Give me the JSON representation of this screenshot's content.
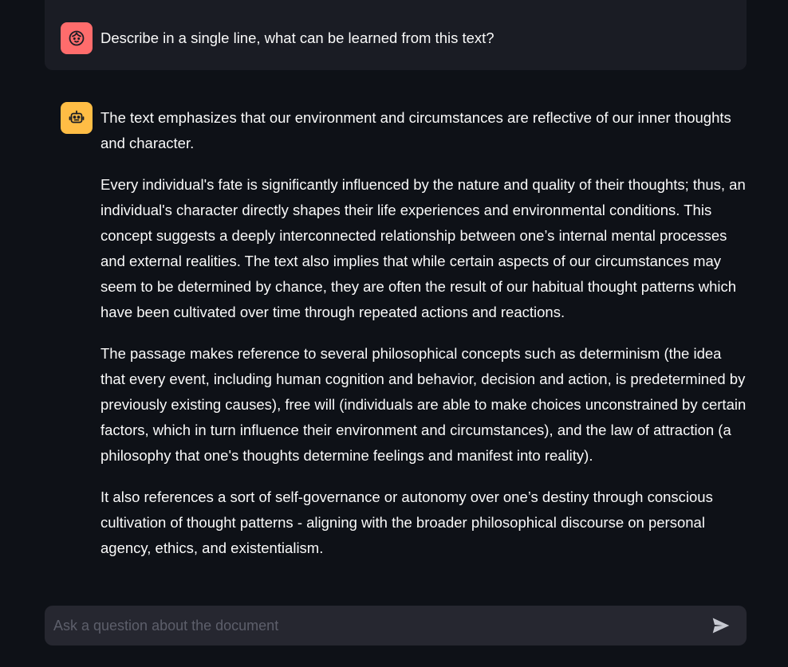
{
  "chat": {
    "user_message": {
      "avatar_icon": "user-face-icon",
      "text": "Describe in a single line, what can be learned from this text?"
    },
    "assistant_message": {
      "avatar_icon": "robot-icon",
      "paragraphs": [
        "The text emphasizes that our environment and circumstances are reflective of our inner thoughts and character.",
        "Every individual's fate is significantly influenced by the nature and quality of their thoughts; thus, an individual's character directly shapes their life experiences and environmental conditions. This concept suggests a deeply interconnected relationship between one’s internal mental processes and external realities. The text also implies that while certain aspects of our circumstances may seem to be determined by chance, they are often the result of our habitual thought patterns which have been cultivated over time through repeated actions and reactions.",
        "The passage makes reference to several philosophical concepts such as determinism (the idea that every event, including human cognition and behavior, decision and action, is predetermined by previously existing causes), free will (individuals are able to make choices unconstrained by certain factors, which in turn influence their environment and circumstances), and the law of attraction (a philosophy that one's thoughts determine feelings and manifest into reality).",
        "It also references a sort of self-governance or autonomy over one’s destiny through conscious cultivation of thought patterns - aligning with the broader philosophical discourse on personal agency, ethics, and existentialism."
      ]
    }
  },
  "input": {
    "placeholder": "Ask a question about the document",
    "value": "",
    "send_icon": "send-icon"
  },
  "colors": {
    "background": "#0e1117",
    "user_avatar": "#ff6c6c",
    "bot_avatar": "#ffbd45",
    "user_bubble": "#1a1c24",
    "input_bg": "#262730"
  }
}
